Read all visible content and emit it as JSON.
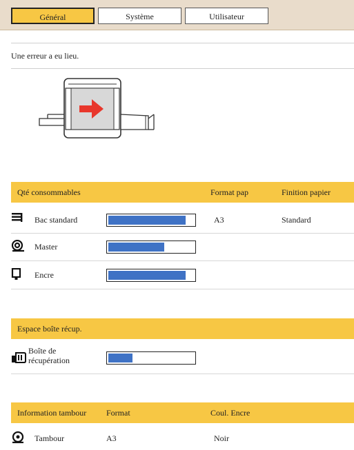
{
  "tabs": [
    {
      "label": "Général",
      "active": true
    },
    {
      "label": "Système",
      "active": false
    },
    {
      "label": "Utilisateur",
      "active": false
    }
  ],
  "message": "Une erreur a eu lieu.",
  "illustration_icon": "printer-arrow-icon",
  "consumables": {
    "headers": [
      "Qté consommables",
      "Format pap",
      "Finition papier"
    ],
    "rows": [
      {
        "icon": "paper-tray-icon",
        "label": "Bac standard",
        "level": 0.9,
        "format": "A3",
        "finish": "Standard"
      },
      {
        "icon": "master-roll-icon",
        "label": "Master",
        "level": 0.65,
        "format": "",
        "finish": ""
      },
      {
        "icon": "ink-cartridge-icon",
        "label": "Encre",
        "level": 0.9,
        "format": "",
        "finish": ""
      }
    ]
  },
  "disposal": {
    "header": "Espace boîte récup.",
    "rows": [
      {
        "icon": "disposal-box-icon",
        "label_line1": "Boîte de",
        "label_line2": "récupération",
        "level": 0.28
      }
    ]
  },
  "drum": {
    "headers": [
      "Information tambour",
      "Format",
      "Coul. Encre"
    ],
    "rows": [
      {
        "icon": "drum-icon",
        "label": "Tambour",
        "format": "A3",
        "ink_color": "Noir"
      }
    ]
  },
  "colors": {
    "accent": "#f7c744",
    "bar_fill": "#3f72c5",
    "arrow": "#e8372c"
  }
}
